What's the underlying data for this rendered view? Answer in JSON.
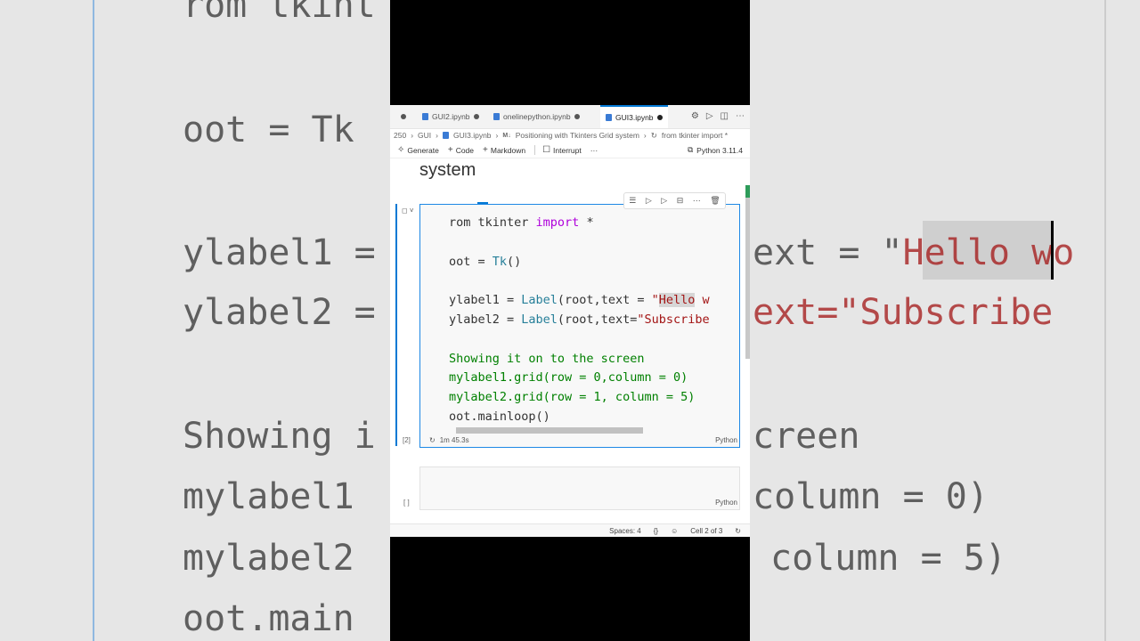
{
  "background_code": {
    "line1": "rom tkint",
    "line2a": "oot = Tk",
    "line3a": "ylabel1 =",
    "line3b": "ext = \"",
    "line3c": "Hello",
    "line3d": " wo",
    "line4a": "ylabel2 =",
    "line4b": "ext=\"Subscribe",
    "line5a": "Showing i",
    "line5b": "creen",
    "line6a": "mylabel1",
    "line6b": "column = 0)",
    "line7a": "mylabel2",
    "line7b": "column = 5)",
    "line8a": "oot.main"
  },
  "tabs": [
    {
      "label": "GUI2.ipynb"
    },
    {
      "label": "onelinepython.ipynb"
    },
    {
      "label": "GUI3.ipynb"
    }
  ],
  "top_icons": [
    "gear-icon",
    "run-icon",
    "split-editor-icon",
    "more-icon"
  ],
  "breadcrumbs": {
    "root": "250",
    "folder": "GUI",
    "file": "GUI3.ipynb",
    "section_prefix": "M↓",
    "section": "Positioning with Tkinters Grid system",
    "cell": "from tkinter import *"
  },
  "toolbar": {
    "generate": "Generate",
    "code": "Code",
    "markdown": "Markdown",
    "interrupt": "Interrupt",
    "more": "···",
    "kernel": "Python 3.11.4"
  },
  "heading": "system",
  "cell_toolbar_icons": [
    "run-by-line-icon",
    "execute-above-icon",
    "execute-below-icon",
    "split-cell-icon",
    "more-icon",
    "delete-icon"
  ],
  "cell1": {
    "exec_count": "[2]",
    "status_time": "1m 45.3s",
    "language": "Python",
    "code": {
      "l1_a": "rom tkinter ",
      "l1_b": "import",
      "l1_c": " *",
      "l2_a": "oot = ",
      "l2_b": "Tk",
      "l2_c": "()",
      "l3_a": "ylabel1 = ",
      "l3_b": "Label",
      "l3_c": "(root,text = ",
      "l3_d": "\"",
      "l3_e": "Hello",
      "l3_f": " w",
      "l4_a": "ylabel2 = ",
      "l4_b": "Label",
      "l4_c": "(root,text=",
      "l4_d": "\"Subscribe",
      "l5": "Showing it on to the screen",
      "l6": "mylabel1.grid(row = 0,column = 0)",
      "l7": "mylabel2.grid(row = 1, column = 5)",
      "l8": "oot.mainloop()"
    }
  },
  "cell2": {
    "exec_count": "[ ]",
    "language": "Python"
  },
  "statusbar": {
    "spaces": "Spaces: 4",
    "braces": "{}",
    "cell": "Cell 2 of 3"
  }
}
